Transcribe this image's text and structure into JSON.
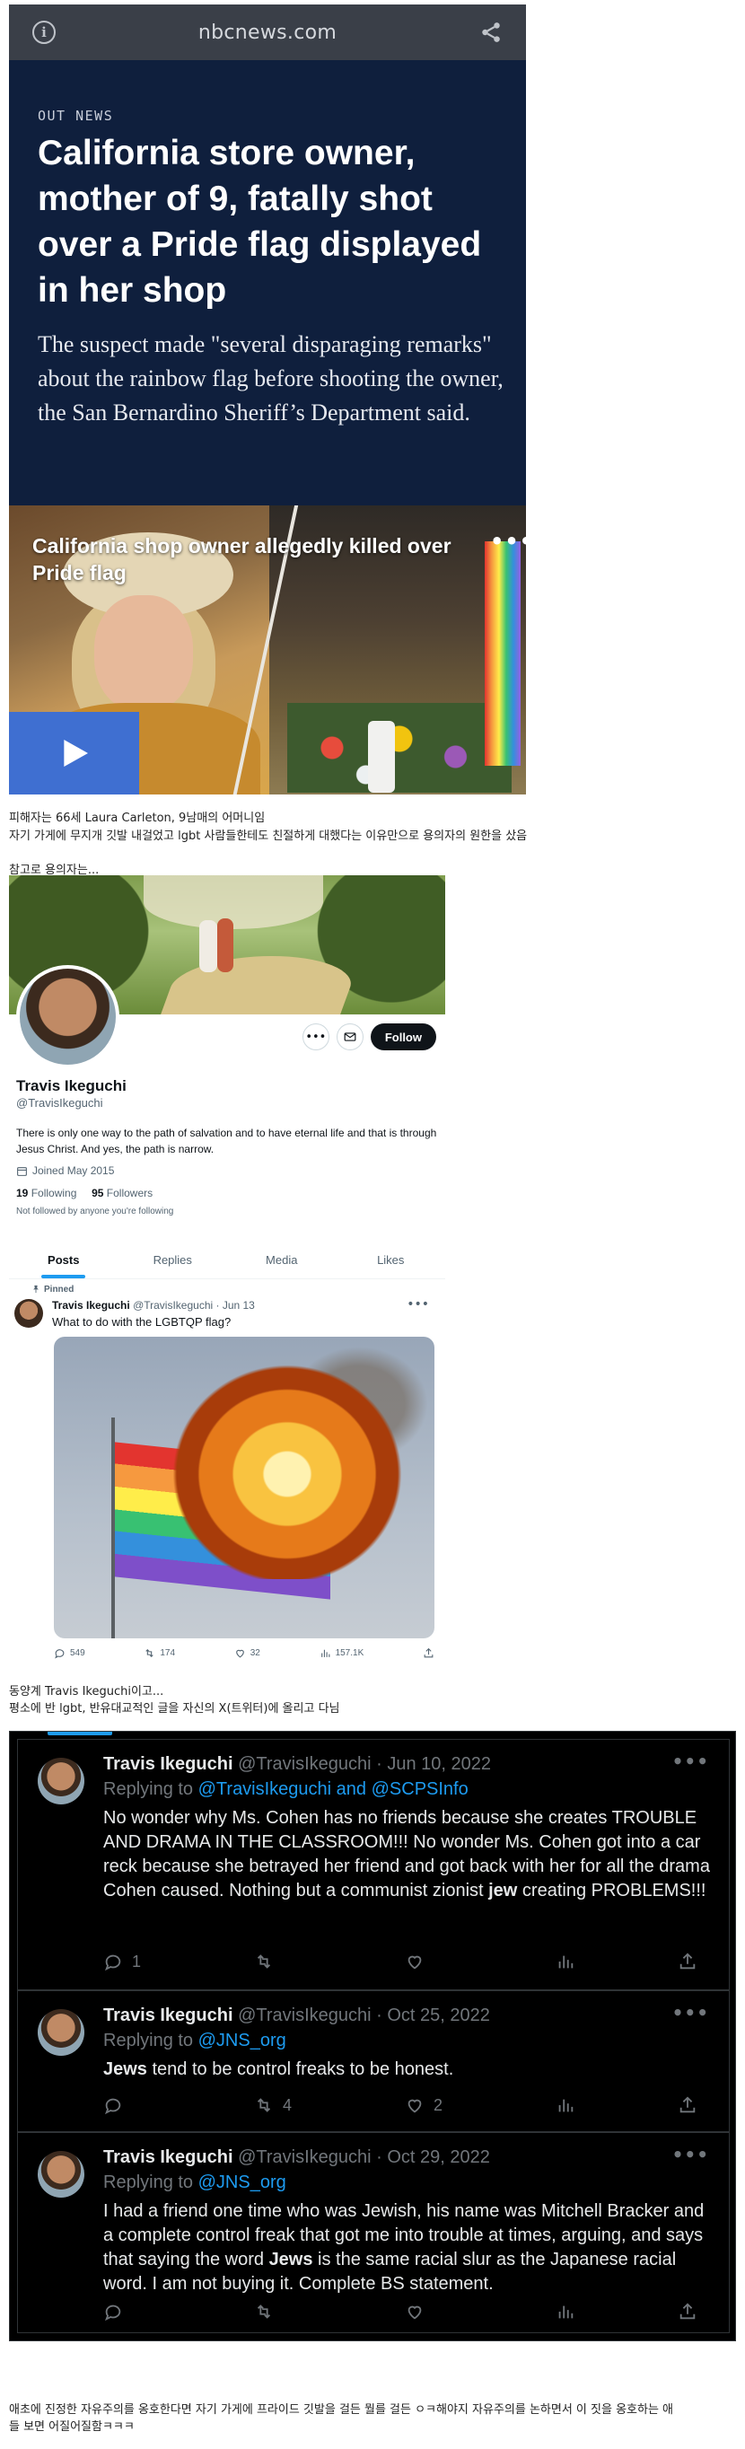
{
  "nbc": {
    "domain": "nbcnews.com",
    "kicker": "OUT NEWS",
    "headline": "California store owner, mother of 9, fatally shot over a Pride flag displayed in her shop",
    "dek": "The suspect made \"several disparaging remarks\" about the rainbow flag before shooting the owner, the San Bernardino Sheriff’s Department said.",
    "video_title": "California shop owner allegedly killed over Pride flag",
    "icons": {
      "info": "info-icon",
      "share": "share-icon",
      "play": "play-icon",
      "more": "more-icon"
    }
  },
  "captions": {
    "c1": "피해자는 66세 Laura Carleton, 9남매의 어머니임",
    "c2": "자기 가게에 무지개 깃발 내걸었고 lgbt 사람들한테도 친절하게 대했다는 이유만으로 용의자의 원한을 샀음",
    "c3": "참고로 용의자는...",
    "c4": "동양계 Travis Ikeguchi이고...",
    "c5": "평소에 반 lgbt, 반유대교적인 글을 자신의 X(트위터)에 올리고 다님",
    "c6": "애초에 진정한 자유주의를 옹호한다면 자기 가게에 프라이드 깃발을 걸든 뭘를 걸든 ㅇㅋ해야지 자유주의를 논하면서 이 짓을 옹호하는 애",
    "c7": "들 보면 어질어질함ㅋㅋㅋ"
  },
  "profile": {
    "name": "Travis Ikeguchi",
    "handle": "@TravisIkeguchi",
    "bio": "There is only one way to the path of salvation and to have eternal life and that is through Jesus Christ. And yes, the path is narrow.",
    "joined": "Joined May 2015",
    "following_count": "19",
    "following_label": "Following",
    "followers_count": "95",
    "followers_label": "Followers",
    "not_followed": "Not followed by anyone you're following",
    "follow_label": "Follow",
    "icons": {
      "more": "more-icon",
      "message": "envelope-icon",
      "calendar": "calendar-icon"
    }
  },
  "tabs": [
    "Posts",
    "Replies",
    "Media",
    "Likes"
  ],
  "pinned": {
    "label": "Pinned",
    "name": "Travis Ikeguchi",
    "meta": "@TravisIkeguchi · Jun 13",
    "text": "What to do with the LGBTQP flag?",
    "replies": "549",
    "retweets": "174",
    "likes": "32",
    "views": "157.1K"
  },
  "dark_tweets": [
    {
      "name": "Travis Ikeguchi",
      "meta": "@TravisIkeguchi · Jun 10, 2022",
      "replying_prefix": "Replying to ",
      "replying_to": "@TravisIkeguchi and @SCPSInfo",
      "body_pre": "No wonder why Ms. Cohen has no friends because she creates TROUBLE AND DRAMA IN THE CLASSROOM!!! No wonder Ms. Cohen got into a car reck because she betrayed her friend and got back with her for all the drama Cohen caused. Nothing but a communist zionist ",
      "body_bold": "jew",
      "body_post": " creating PROBLEMS!!!",
      "replies": "1",
      "retweets": "",
      "likes": ""
    },
    {
      "name": "Travis Ikeguchi",
      "meta": "@TravisIkeguchi · Oct 25, 2022",
      "replying_prefix": "Replying to ",
      "replying_to": "@JNS_org",
      "body_pre": "",
      "body_bold": "Jews",
      "body_post": " tend to be control freaks to be honest.",
      "replies": "",
      "retweets": "4",
      "likes": "2"
    },
    {
      "name": "Travis Ikeguchi",
      "meta": "@TravisIkeguchi · Oct 29, 2022",
      "replying_prefix": "Replying to ",
      "replying_to": "@JNS_org",
      "body_pre": "I had a friend one time who was Jewish, his name was Mitchell Bracker and a complete control freak that got me into trouble at times, arguing, and says that saying the word ",
      "body_bold": "Jews",
      "body_post": " is the same racial slur as the Japanese racial word. I am not buying it. Complete BS statement.",
      "replies": "",
      "retweets": "",
      "likes": ""
    }
  ],
  "colors": {
    "nbc_bg": "#0f1f3d",
    "x_blue": "#1d9bf0",
    "x_dark": "#000000",
    "x_muted": "#71767b"
  }
}
